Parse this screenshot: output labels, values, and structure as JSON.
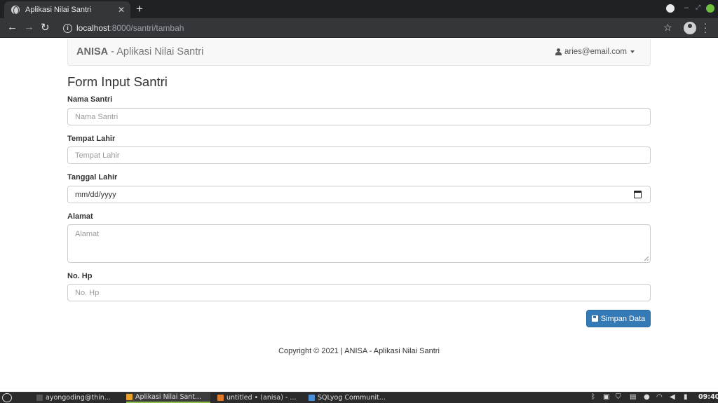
{
  "browser": {
    "tab_title": "Aplikasi Nilai Santri",
    "tab_close": "✕",
    "new_tab": "+",
    "url_host": "localhost",
    "url_path": ":8000/santri/tambah",
    "info_glyph": "i"
  },
  "navbar": {
    "brand_bold": "ANISA",
    "brand_rest": " - Aplikasi Nilai Santri",
    "user_email": "aries@email.com"
  },
  "form": {
    "title": "Form Input Santri",
    "fields": [
      {
        "label": "Nama Santri",
        "placeholder": "Nama Santri"
      },
      {
        "label": "Tempat Lahir",
        "placeholder": "Tempat Lahir"
      },
      {
        "label": "Tanggal Lahir",
        "placeholder": "mm/dd/yyyy"
      },
      {
        "label": "Alamat",
        "placeholder": "Alamat"
      },
      {
        "label": "No. Hp",
        "placeholder": "No. Hp"
      }
    ],
    "submit_label": "Simpan Data"
  },
  "footer": {
    "text": "Copyright © 2021 | ANISA - Aplikasi Nilai Santri"
  },
  "taskbar": {
    "tasks": [
      {
        "label": "ayongoding@thin...",
        "icon_color": "#555555"
      },
      {
        "label": "Aplikasi Nilai Sant...",
        "icon_color": "#e8a02a"
      },
      {
        "label": "untitled • (anisa) - ...",
        "icon_color": "#e07b2a"
      },
      {
        "label": "SQLyog Communit...",
        "icon_color": "#4a8fd8"
      }
    ],
    "clock": "09:40"
  },
  "colors": {
    "primary_button": "#337ab7",
    "navbar_bg": "#f8f8f8",
    "browser_chrome": "#35363a"
  }
}
